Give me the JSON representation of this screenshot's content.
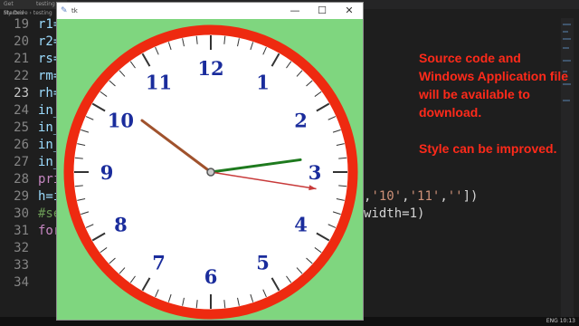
{
  "editor": {
    "tabs": [
      "Get Started",
      "testing"
    ],
    "breadcrumb": "My Drive › testing",
    "lines": [
      {
        "num": "19",
        "code": "r1=",
        "active": false
      },
      {
        "num": "20",
        "code": "r2=",
        "active": false
      },
      {
        "num": "21",
        "code": "rs=",
        "active": false
      },
      {
        "num": "22",
        "code": "rm=",
        "active": false
      },
      {
        "num": "23",
        "code": "rh=",
        "active": true
      },
      {
        "num": "24",
        "code": "in_",
        "active": false
      },
      {
        "num": "25",
        "code": "in_",
        "active": false
      },
      {
        "num": "26",
        "code": "in_",
        "active": false
      },
      {
        "num": "27",
        "code": "in_",
        "active": false
      },
      {
        "num": "28",
        "code": "pri",
        "active": false
      },
      {
        "num": "29",
        "code": "h=i",
        "active": false
      },
      {
        "num": "30",
        "code": "#se",
        "active": false
      },
      {
        "num": "31",
        "code": "for",
        "active": false
      },
      {
        "num": "32",
        "code": "",
        "active": false
      },
      {
        "num": "33",
        "code": "",
        "active": false
      },
      {
        "num": "34",
        "code": "",
        "active": false
      }
    ],
    "line29_tail": {
      "s1": "'10'",
      "s2": "'11'",
      "s3": "''",
      "close": "])"
    },
    "line30_tail": "width=1)"
  },
  "note": {
    "paragraph1": "Source code and Windows Application file will be available to download.",
    "paragraph2": "Style can be improved."
  },
  "tk_window": {
    "icon": "feather-icon",
    "title": "tk",
    "minimize": "—",
    "maximize": "☐",
    "close": "✕"
  },
  "clock": {
    "numbers": [
      "12",
      "1",
      "2",
      "3",
      "4",
      "5",
      "6",
      "7",
      "8",
      "9",
      "10",
      "11"
    ],
    "time": {
      "hours": 10,
      "minutes": 13.7,
      "seconds": 16.5
    },
    "colors": {
      "background": "#7fd67f",
      "rim": "#ee2a10",
      "face": "#ffffff",
      "numbers": "#1a2c9c",
      "hour_hand": "#a0522d",
      "minute_hand": "#1e7a1e",
      "second_hand": "#c83a3a"
    }
  },
  "taskbar": {
    "tray": "ENG 10:13"
  }
}
